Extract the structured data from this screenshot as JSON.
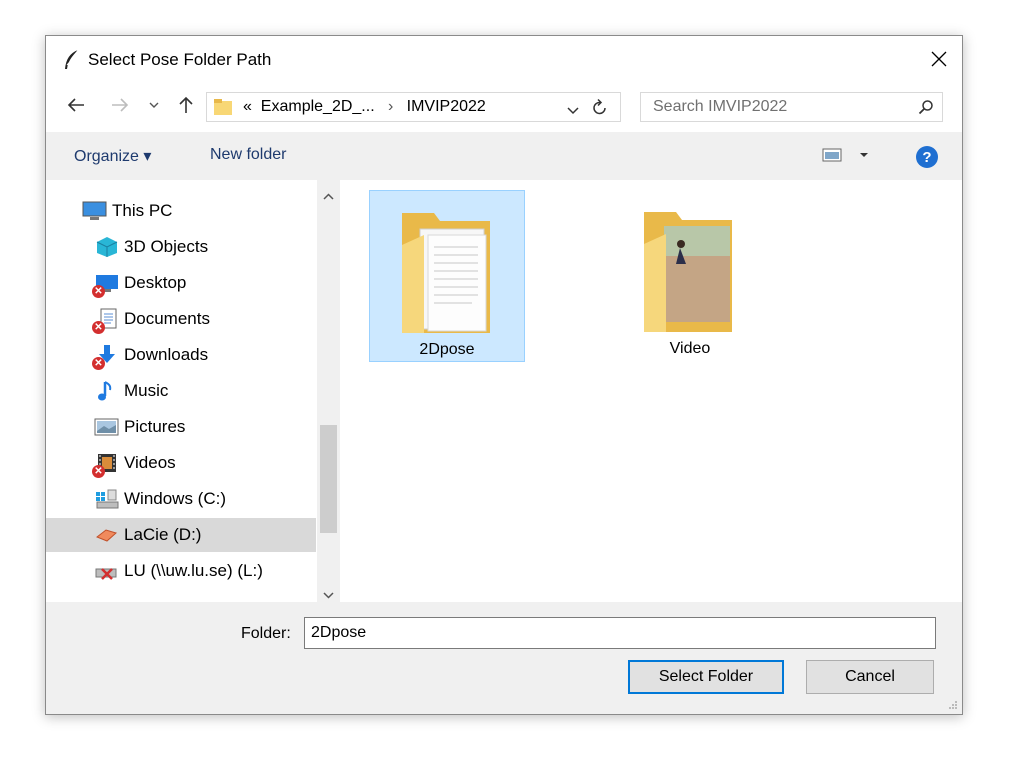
{
  "window": {
    "title": "Select Pose Folder Path",
    "close_icon": "close-icon"
  },
  "navigation": {
    "back_icon": "arrow-left-icon",
    "forward_icon": "arrow-right-icon",
    "recent_icon": "chevron-down-icon",
    "up_icon": "arrow-up-icon",
    "address": {
      "overflow": "«",
      "crumb1": "Example_2D_...",
      "separator": "›",
      "crumb2": "IMVIP2022"
    },
    "refresh_icon": "refresh-icon",
    "search_placeholder": "Search IMVIP2022"
  },
  "toolbar": {
    "organize_label": "Organize ▾",
    "new_folder_label": "New folder",
    "help_label": "?"
  },
  "sidebar": {
    "items": [
      {
        "label": "This PC",
        "icon": "computer-icon"
      },
      {
        "label": "3D Objects",
        "icon": "cube-icon"
      },
      {
        "label": "Desktop",
        "icon": "desktop-icon",
        "error": true
      },
      {
        "label": "Documents",
        "icon": "documents-icon",
        "error": true
      },
      {
        "label": "Downloads",
        "icon": "download-icon",
        "error": true
      },
      {
        "label": "Music",
        "icon": "music-icon"
      },
      {
        "label": "Pictures",
        "icon": "pictures-icon"
      },
      {
        "label": "Videos",
        "icon": "video-icon",
        "error": true
      },
      {
        "label": "Windows (C:)",
        "icon": "drive-icon"
      },
      {
        "label": "LaCie (D:)",
        "icon": "external-drive-icon",
        "selected": true
      },
      {
        "label": "LU (\\\\uw.lu.se) (L:)",
        "icon": "network-drive-icon"
      }
    ]
  },
  "content": {
    "items": [
      {
        "label": "2Dpose",
        "selected": true
      },
      {
        "label": "Video",
        "selected": false
      }
    ]
  },
  "footer": {
    "folder_label": "Folder:",
    "folder_value": "2Dpose",
    "select_button": "Select Folder",
    "cancel_button": "Cancel"
  },
  "colors": {
    "selection": "#cce8ff",
    "accent": "#0078d7",
    "link": "#1e3a6e"
  }
}
